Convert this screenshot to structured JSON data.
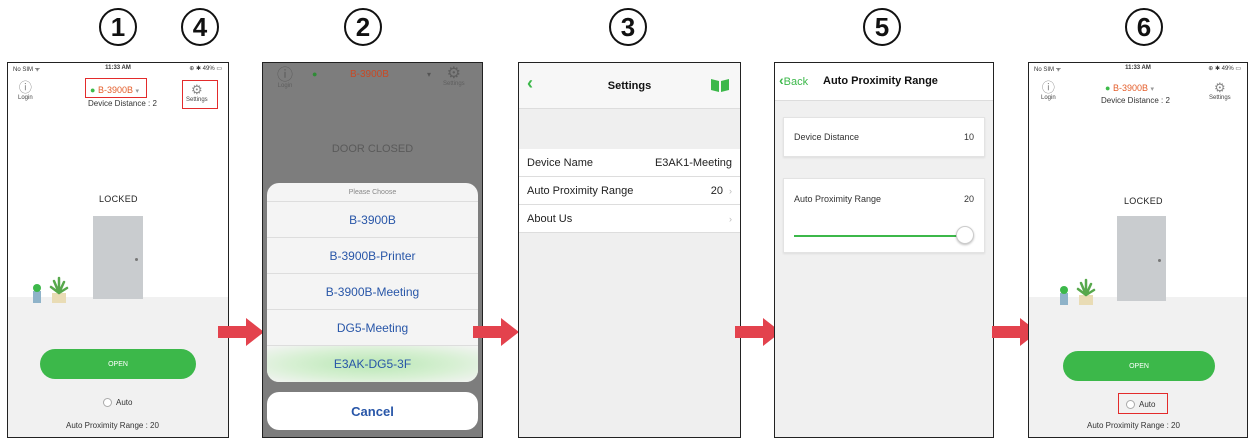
{
  "steps": [
    "1",
    "4",
    "2",
    "3",
    "5",
    "6"
  ],
  "colors": {
    "accent": "#3cb84a",
    "device": "#e45d2a",
    "highlight": "#e32b2b",
    "link": "#2856a8"
  },
  "home": {
    "status_left": "No SIM ᯤ",
    "status_time": "11:33 AM",
    "status_right": "⊕ ✱ 49% ▭",
    "login": "Login",
    "device": "B-3900B",
    "device_distance": "Device Distance : 2",
    "settings": "Settings",
    "state": "LOCKED",
    "open": "OPEN",
    "auto": "Auto",
    "apr": "Auto Proximity Range : 20"
  },
  "picker": {
    "device": "B-3900B",
    "login": "Login",
    "settings": "Settings",
    "door_status": "DOOR CLOSED",
    "title": "Please Choose",
    "options": [
      {
        "name": "B-3900B",
        "suffix": ""
      },
      {
        "name": "B-3900B",
        "suffix": "-Printer"
      },
      {
        "name": "B-3900B",
        "suffix": "-Meeting"
      },
      {
        "name": "DG5-Meeting",
        "suffix": ""
      },
      {
        "name": "E3AK-DG5-3F",
        "suffix": ""
      }
    ],
    "cancel": "Cancel"
  },
  "settings": {
    "title": "Settings",
    "rows": [
      {
        "label": "Device Name",
        "value": "E3AK1-Meeting"
      },
      {
        "label": "Auto Proximity Range",
        "value": "20"
      },
      {
        "label": "About Us",
        "value": ""
      }
    ]
  },
  "apr_page": {
    "back": "Back",
    "title": "Auto Proximity Range",
    "device_distance_label": "Device Distance",
    "device_distance_value": "10",
    "apr_label": "Auto Proximity Range",
    "apr_value": "20",
    "slider_fraction": 1.0
  },
  "icons": [
    "info-icon",
    "gear-icon",
    "chevron-left-icon",
    "book-icon",
    "chevron-right-icon",
    "arrow-right-icon",
    "plant-icon",
    "door-icon"
  ]
}
